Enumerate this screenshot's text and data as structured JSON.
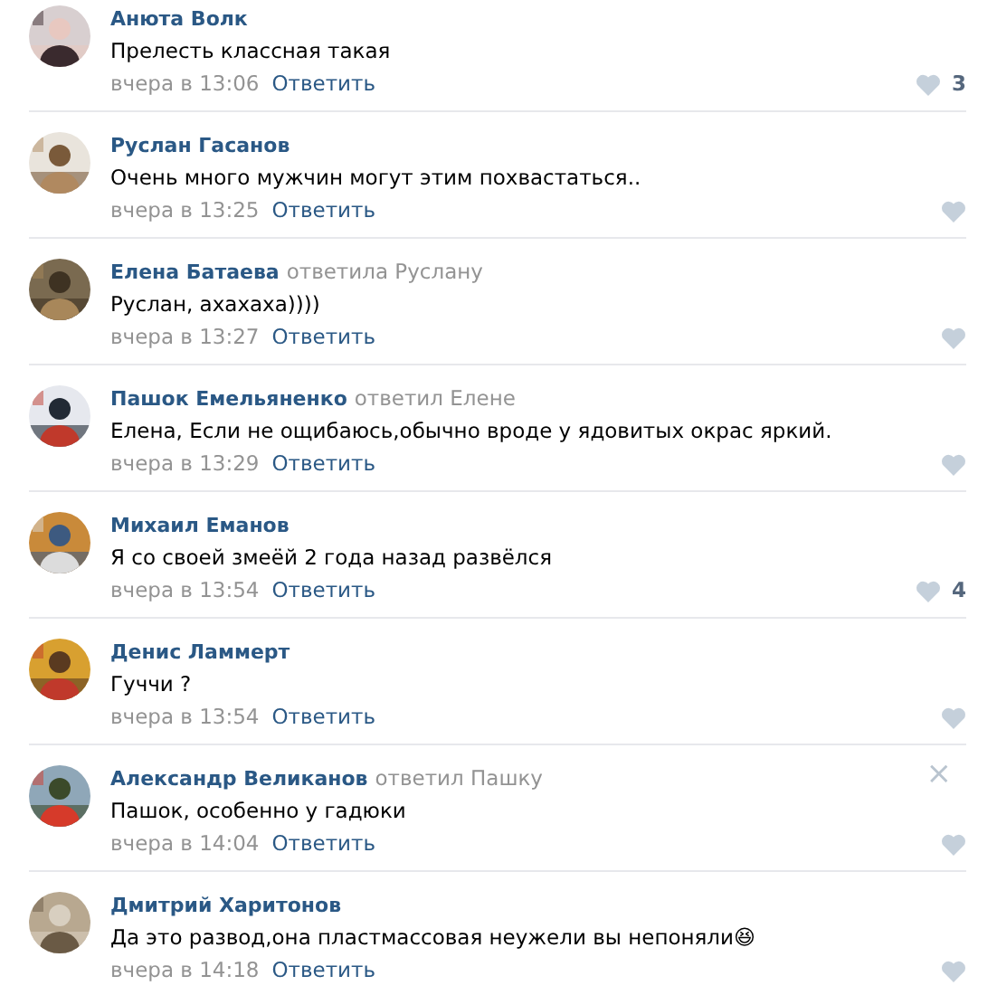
{
  "comments": [
    {
      "author": "Анюта Волк",
      "text": "Прелесть классная такая",
      "time": "вчера в 13:06",
      "reply_label": "Ответить",
      "likes": "3"
    },
    {
      "author": "Руслан Гасанов",
      "text": "Очень много мужчин могут этим похвастаться..",
      "time": "вчера в 13:25",
      "reply_label": "Ответить"
    },
    {
      "author": "Елена Батаева",
      "reply_to": "ответила Руслану",
      "text": "Руслан, ахахаха))))",
      "time": "вчера в 13:27",
      "reply_label": "Ответить"
    },
    {
      "author": "Пашок Емельяненко",
      "reply_to": "ответил Елене",
      "text": "Елена, Если не ощибаюсь,обычно вроде у ядовитых окрас яркий.",
      "time": "вчера в 13:29",
      "reply_label": "Ответить"
    },
    {
      "author": "Михаил Еманов",
      "text": "Я со своей змеёй 2 года назад развёлся",
      "time": "вчера в 13:54",
      "reply_label": "Ответить",
      "likes": "4"
    },
    {
      "author": "Денис Ламмерт",
      "text": "Гуччи ?",
      "time": "вчера в 13:54",
      "reply_label": "Ответить"
    },
    {
      "author": "Александр Великанов",
      "reply_to": "ответил Пашку",
      "text": "Пашок, особенно у гадюки",
      "time": "вчера в 14:04",
      "reply_label": "Ответить",
      "close_icon": "×"
    },
    {
      "author": "Дмитрий Харитонов",
      "text": "Да это развод,она пластмассовая неужели вы непоняли😆",
      "time": "вчера в 14:18",
      "reply_label": "Ответить"
    }
  ]
}
